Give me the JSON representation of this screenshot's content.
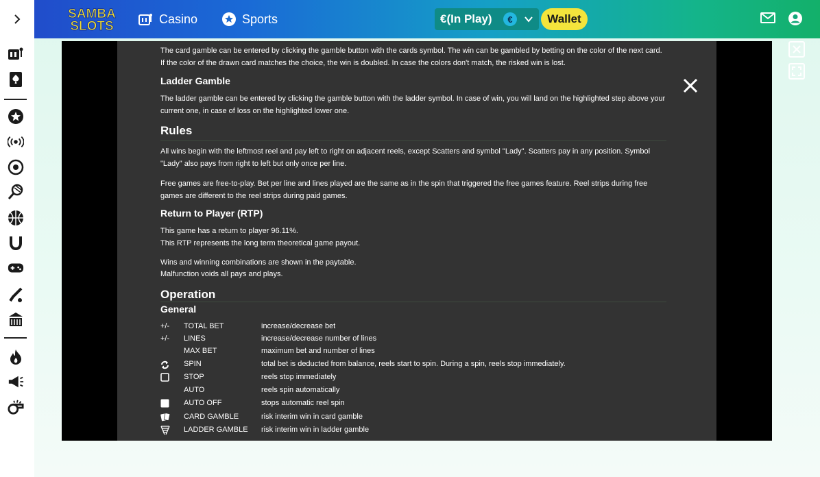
{
  "header": {
    "logo_line1": "SAMBA",
    "logo_line2": "SLOTS",
    "nav": [
      {
        "label": "Casino",
        "icon": "slot-machine-icon"
      },
      {
        "label": "Sports",
        "icon": "soccer-star-icon"
      }
    ],
    "balance_label": "€(In Play)",
    "currency_symbol": "€",
    "wallet_label": "Wallet"
  },
  "sidebar": {
    "items": [
      "slot-machine-icon",
      "spade-card-icon",
      "star-icon",
      "live-signal-icon",
      "soccer-ball-icon",
      "tennis-icon",
      "basketball-icon",
      "horseshoe-icon",
      "gamepad-icon",
      "cricket-icon",
      "casino-table-icon",
      "fire-icon",
      "megaphone-icon",
      "whistle-icon"
    ]
  },
  "help": {
    "card_gamble_text": "The card gamble can be entered by clicking the gamble button with the cards symbol. The win can be gambled by betting on the color of the next card. If the color of the drawn card matches the choice, the win is doubled. In case the colors don't match, the risked win is lost.",
    "ladder_title": "Ladder Gamble",
    "ladder_text": "The ladder gamble can be entered by clicking the gamble button with the ladder symbol. In case of win, you will land on the highlighted step above your current one, in case of loss on the highlighted lower one.",
    "rules_title": "Rules",
    "rules_text1": "All wins begin with the leftmost reel and pay left to right on adjacent reels, except Scatters and symbol \"Lady\". Scatters pay in any position. Symbol \"Lady\" also pays from right to left but only once per line.",
    "rules_text2": "Free games are free-to-play. Bet per line and lines played are the same as in the spin that triggered the free games feature. Reel strips during free games are different to the reel strips during paid games.",
    "rtp_title": "Return to Player (RTP)",
    "rtp_line1": "This game has a return to player 96.11%.",
    "rtp_line2": "This RTP represents the long term theoretical game payout.",
    "wins_line1": "Wins and winning combinations are shown in the paytable.",
    "wins_line2": "Malfunction voids all pays and plays.",
    "operation_title": "Operation",
    "general_title": "General",
    "controls": [
      {
        "sym": "+/-",
        "key": "TOTAL BET",
        "desc": "increase/decrease bet"
      },
      {
        "sym": "+/-",
        "key": "LINES",
        "desc": "increase/decrease number of lines"
      },
      {
        "sym": "",
        "key": "MAX BET",
        "desc": "maximum bet and number of lines"
      },
      {
        "sym": "",
        "key": "SPIN",
        "desc": "total bet is deducted from balance, reels start to spin. During a spin, reels stop immediately."
      },
      {
        "sym": "",
        "key": "STOP",
        "desc": "reels stop immediately"
      },
      {
        "sym": "",
        "key": "AUTO",
        "desc": "reels spin automatically"
      },
      {
        "sym": "",
        "key": "AUTO OFF",
        "desc": "stops automatic reel spin"
      },
      {
        "sym": "",
        "key": "CARD GAMBLE",
        "desc": "risk interim win in card gamble"
      },
      {
        "sym": "",
        "key": "LADDER GAMBLE",
        "desc": "risk interim win in ladder gamble"
      }
    ]
  }
}
